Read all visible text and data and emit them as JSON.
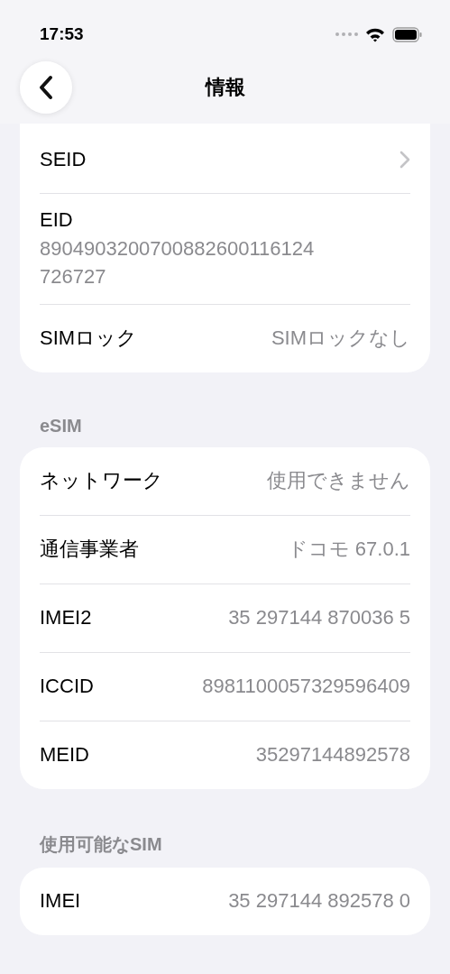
{
  "status_bar": {
    "time": "17:53"
  },
  "nav": {
    "title": "情報"
  },
  "sections": [
    {
      "rows": [
        {
          "label": "SEID",
          "kind": "link"
        },
        {
          "label": "EID",
          "value": "8904903200700882600116124726727",
          "kind": "stacked"
        },
        {
          "label": "SIMロック",
          "value": "SIMロックなし",
          "kind": "pair"
        }
      ]
    },
    {
      "header": "eSIM",
      "rows": [
        {
          "label": "ネットワーク",
          "value": "使用できません",
          "kind": "pair"
        },
        {
          "label": "通信事業者",
          "value": "ドコモ 67.0.1",
          "kind": "pair"
        },
        {
          "label": "IMEI2",
          "value": "35 297144 870036 5",
          "kind": "pair"
        },
        {
          "label": "ICCID",
          "value": "8981100057329596409",
          "kind": "pair"
        },
        {
          "label": "MEID",
          "value": "35297144892578",
          "kind": "pair"
        }
      ]
    },
    {
      "header": "使用可能なSIM",
      "rows": [
        {
          "label": "IMEI",
          "value": "35 297144 892578 0",
          "kind": "pair"
        }
      ]
    }
  ]
}
